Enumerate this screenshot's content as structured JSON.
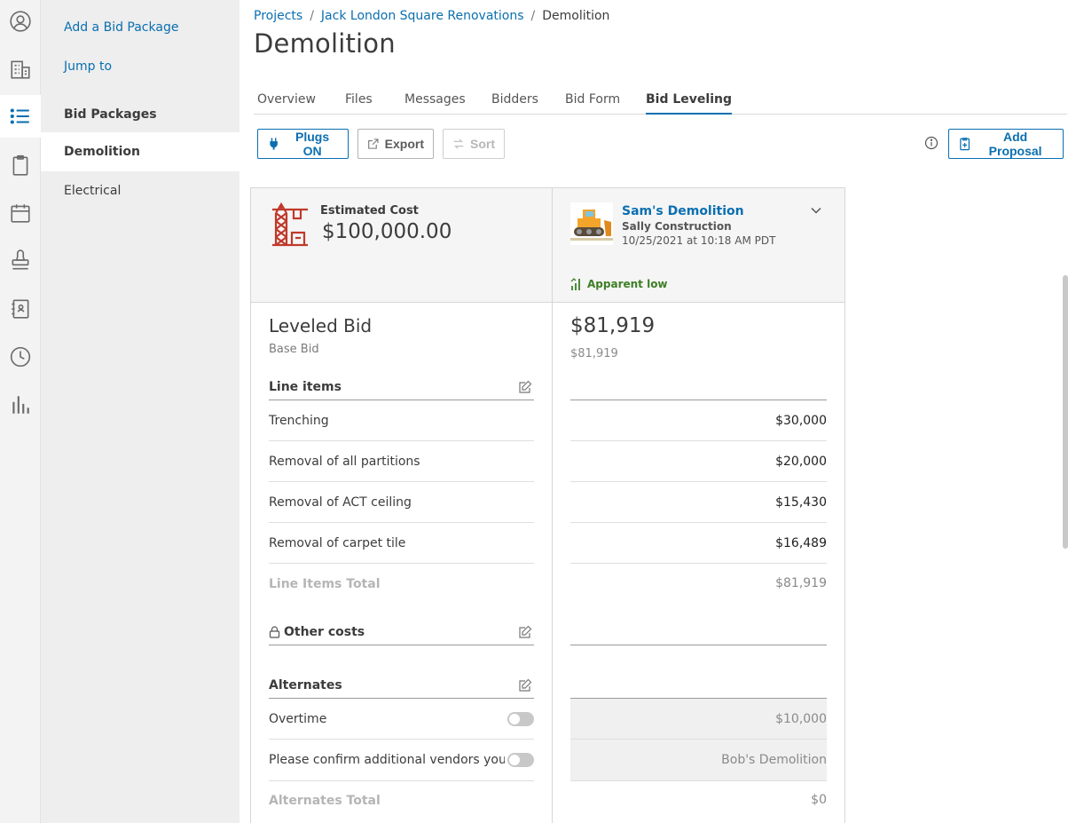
{
  "subnav": {
    "add_bid_package": "Add a Bid Package",
    "jump_to": "Jump to",
    "bid_packages": "Bid Packages",
    "items": [
      {
        "label": "Demolition"
      },
      {
        "label": "Electrical"
      }
    ]
  },
  "breadcrumb": {
    "projects": "Projects",
    "project": "Jack London Square Renovations",
    "current": "Demolition",
    "separator": "/"
  },
  "page": {
    "title": "Demolition"
  },
  "tabs": [
    {
      "label": "Overview"
    },
    {
      "label": "Files"
    },
    {
      "label": "Messages"
    },
    {
      "label": "Bidders"
    },
    {
      "label": "Bid Form"
    },
    {
      "label": "Bid Leveling"
    }
  ],
  "toolbar": {
    "plugs": "Plugs ON",
    "export": "Export",
    "sort": "Sort",
    "add_proposal": "Add Proposal"
  },
  "estimate": {
    "label": "Estimated Cost",
    "value": "$100,000.00"
  },
  "bidder": {
    "name": "Sam's Demolition",
    "company": "Sally Construction",
    "date": "10/25/2021 at 10:18 AM PDT",
    "status": "Apparent low",
    "bid_total": "$81,919",
    "base_bid": "$81,919"
  },
  "leveled": {
    "title": "Leveled Bid",
    "subtitle": "Base Bid"
  },
  "line_items": {
    "header": "Line items",
    "rows": [
      {
        "label": "Trenching",
        "value": "$30,000"
      },
      {
        "label": "Removal of all partitions",
        "value": "$20,000"
      },
      {
        "label": "Removal of ACT ceiling",
        "value": "$15,430"
      },
      {
        "label": "Removal of carpet tile",
        "value": "$16,489"
      }
    ],
    "total_label": "Line Items Total",
    "total_value": "$81,919"
  },
  "other_costs": {
    "header": "Other costs"
  },
  "alternates": {
    "header": "Alternates",
    "rows": [
      {
        "label": "Overtime",
        "value": "$10,000"
      },
      {
        "label": "Please confirm additional vendors you ...",
        "value": "Bob's Demolition"
      }
    ],
    "total_label": "Alternates Total",
    "total_value": "$0"
  },
  "colors": {
    "accent": "#0a6fb0",
    "apparent_low": "#3d7f25",
    "estimate_icon": "#c0392b"
  }
}
